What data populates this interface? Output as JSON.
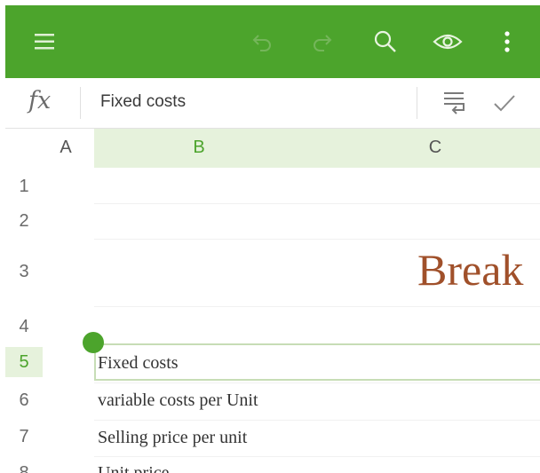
{
  "colors": {
    "toolbar": "#4ca42c",
    "selection": "#e6f2dc",
    "title": "#a0502a"
  },
  "toolbar": {
    "icons": [
      "menu-icon",
      "undo-icon",
      "redo-icon",
      "search-icon",
      "eye-icon",
      "more-vert-icon"
    ]
  },
  "formula_bar": {
    "fx_label": "fx",
    "value": "Fixed costs",
    "icons": [
      "wrap-text-icon",
      "checkmark-icon"
    ]
  },
  "grid": {
    "columns": [
      "A",
      "B",
      "C"
    ],
    "rows": [
      "1",
      "2",
      "3",
      "4",
      "5",
      "6",
      "7",
      "8"
    ],
    "selected_column": "B",
    "selected_row": "5",
    "title": "Break",
    "cells": {
      "b5": "Fixed costs",
      "b6": "variable costs per Unit",
      "b7": "Selling price per unit",
      "b8": "Unit price"
    }
  }
}
